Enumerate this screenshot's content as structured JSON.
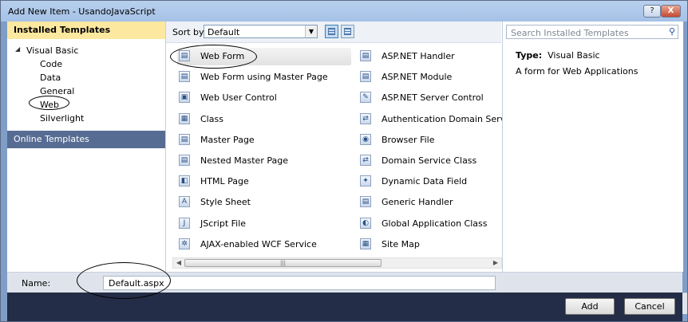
{
  "window": {
    "title": "Add New Item - UsandoJavaScript",
    "help_glyph": "?",
    "close_glyph": "X"
  },
  "sidebar": {
    "installed_header": "Installed Templates",
    "tree_root": "Visual Basic",
    "tree_root_glyph": "◢",
    "tree_items": [
      "Code",
      "Data",
      "General",
      "Web",
      "Silverlight"
    ],
    "online": "Online Templates"
  },
  "sortbar": {
    "label": "Sort by:",
    "selected": "Default",
    "dropdown_glyph": "▼"
  },
  "templates_col1": [
    {
      "label": "Web Form",
      "icon": "web-form-icon",
      "glyph": "▤"
    },
    {
      "label": "Web Form using Master Page",
      "icon": "web-form-master-icon",
      "glyph": "▤"
    },
    {
      "label": "Web User Control",
      "icon": "web-user-control-icon",
      "glyph": "▣"
    },
    {
      "label": "Class",
      "icon": "class-icon",
      "glyph": "▦"
    },
    {
      "label": "Master Page",
      "icon": "master-page-icon",
      "glyph": "▤"
    },
    {
      "label": "Nested Master Page",
      "icon": "nested-master-page-icon",
      "glyph": "▤"
    },
    {
      "label": "HTML Page",
      "icon": "html-page-icon",
      "glyph": "◧"
    },
    {
      "label": "Style Sheet",
      "icon": "style-sheet-icon",
      "glyph": "A"
    },
    {
      "label": "JScript File",
      "icon": "jscript-file-icon",
      "glyph": "J"
    },
    {
      "label": "AJAX-enabled WCF Service",
      "icon": "ajax-wcf-service-icon",
      "glyph": "✲"
    }
  ],
  "templates_col2": [
    {
      "label": "ASP.NET Handler",
      "icon": "aspnet-handler-icon",
      "glyph": "▤"
    },
    {
      "label": "ASP.NET Module",
      "icon": "aspnet-module-icon",
      "glyph": "▤"
    },
    {
      "label": "ASP.NET Server Control",
      "icon": "aspnet-server-control-icon",
      "glyph": "✎"
    },
    {
      "label": "Authentication Domain Service",
      "icon": "auth-domain-service-icon",
      "glyph": "⇄"
    },
    {
      "label": "Browser File",
      "icon": "browser-file-icon",
      "glyph": "◉"
    },
    {
      "label": "Domain Service Class",
      "icon": "domain-service-class-icon",
      "glyph": "⇄"
    },
    {
      "label": "Dynamic Data Field",
      "icon": "dynamic-data-field-icon",
      "glyph": "✦"
    },
    {
      "label": "Generic Handler",
      "icon": "generic-handler-icon",
      "glyph": "▤"
    },
    {
      "label": "Global Application Class",
      "icon": "global-app-class-icon",
      "glyph": "◐"
    },
    {
      "label": "Site Map",
      "icon": "site-map-icon",
      "glyph": "▦"
    }
  ],
  "scrollbar": {
    "left_glyph": "◀",
    "right_glyph": "▶",
    "grip": "|||"
  },
  "details": {
    "search_placeholder": "Search Installed Templates",
    "search_glyph": "⚲",
    "type_label": "Type:",
    "type_value": "Visual Basic",
    "description": "A form for Web Applications"
  },
  "name_row": {
    "label": "Name:",
    "value": "Default.aspx"
  },
  "buttons": {
    "add": "Add",
    "cancel": "Cancel"
  },
  "colors": {
    "header_bg": "#fde8a0",
    "online_bg": "#566c92",
    "footer_bg": "#232d47",
    "titlebar": "#a5c1e6"
  }
}
